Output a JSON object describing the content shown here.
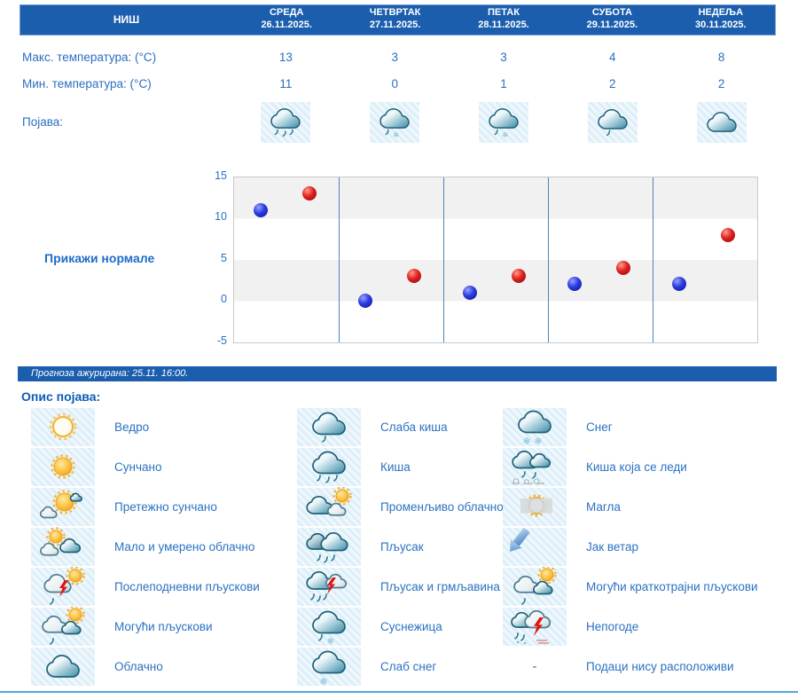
{
  "header": {
    "station": "НИШ"
  },
  "row_labels": {
    "max": "Макс. температура: (°C)",
    "min": "Мин. температура: (°C)",
    "phenomena": "Појава:"
  },
  "days": [
    {
      "name": "СРЕДА",
      "date": "26.11.2025.",
      "max": "13",
      "min": "11",
      "icon": "cloud-rain3"
    },
    {
      "name": "ЧЕТВРТАК",
      "date": "27.11.2025.",
      "max": "3",
      "min": "0",
      "icon": "cloud-sleet"
    },
    {
      "name": "ПЕТАК",
      "date": "28.11.2025.",
      "max": "3",
      "min": "1",
      "icon": "cloud-sleet"
    },
    {
      "name": "СУБОТА",
      "date": "29.11.2025.",
      "max": "4",
      "min": "2",
      "icon": "cloud-rain1"
    },
    {
      "name": "НЕДЕЉА",
      "date": "30.11.2025.",
      "max": "8",
      "min": "2",
      "icon": "cloud"
    }
  ],
  "normals_link": "Прикажи нормале",
  "updated_text": "Прогноза ажурирана:  25.11. 16:00.",
  "legend_title": "Опис појава:",
  "dash_symbol": "-",
  "chart_data": {
    "type": "scatter",
    "categories": [
      "СРЕДА 26.11.2025.",
      "ЧЕТВРТАК 27.11.2025.",
      "ПЕТАК 28.11.2025.",
      "СУБОТА 29.11.2025.",
      "НЕДЕЉА 30.11.2025."
    ],
    "series": [
      {
        "name": "Мин. температура (°C)",
        "color": "#1b2fd4",
        "values": [
          11,
          0,
          1,
          2,
          2
        ]
      },
      {
        "name": "Макс. температура (°C)",
        "color": "#d41a1a",
        "values": [
          13,
          3,
          3,
          4,
          8
        ]
      }
    ],
    "ylim": [
      -5,
      15
    ],
    "yticks": [
      15,
      10,
      5,
      0,
      -5
    ],
    "grid": "horizontal-bands-and-day-separators",
    "legend_position": "none",
    "title": "",
    "xlabel": "",
    "ylabel": ""
  },
  "legend_columns": [
    [
      {
        "icon": "sun-outline",
        "label": "Ведро"
      },
      {
        "icon": "sun",
        "label": "Сунчано"
      },
      {
        "icon": "sun-cloud",
        "label": "Претежно сунчано"
      },
      {
        "icon": "clouds-sun",
        "label": "Мало и умерено облачно"
      },
      {
        "icon": "cloud-sun-storm",
        "label": "Послеподневни пљускови"
      },
      {
        "icon": "clouds-sun-rain1",
        "label": "Могући пљускови"
      },
      {
        "icon": "cloud",
        "label": "Облачно"
      }
    ],
    [
      {
        "icon": "cloud-rain1",
        "label": "Слаба киша"
      },
      {
        "icon": "cloud-rain3",
        "label": "Киша"
      },
      {
        "icon": "clouds-sun2",
        "label": "Променљиво облачно"
      },
      {
        "icon": "clouds-rain",
        "label": "Пљусак"
      },
      {
        "icon": "cloud-storm-rain",
        "label": "Пљусак и грмљавина"
      },
      {
        "icon": "cloud-sleet",
        "label": "Суснежица"
      },
      {
        "icon": "cloud-snow1",
        "label": "Слаб снег"
      }
    ],
    [
      {
        "icon": "cloud-snow2",
        "label": "Снег"
      },
      {
        "icon": "clouds-freezing-rain",
        "label": "Киша која се леди"
      },
      {
        "icon": "fog",
        "label": "Магла"
      },
      {
        "icon": "wind",
        "label": "Јак ветар"
      },
      {
        "icon": "clouds-sun-rain1",
        "label": "Могући краткотрајни пљускови"
      },
      {
        "icon": "cloud-storm-severe",
        "label": "Непогоде"
      },
      {
        "icon": "dash",
        "label": "Подаци нису расположиви"
      }
    ]
  ],
  "colors": {
    "header_bg": "#1b5eae",
    "text_blue": "#2a6fc0",
    "band_gray": "#f1f1f1",
    "day_separator": "#4c86bb",
    "min_dot": "#1b2fd4",
    "max_dot": "#d41a1a",
    "bottom_line": "#57a7dc"
  }
}
